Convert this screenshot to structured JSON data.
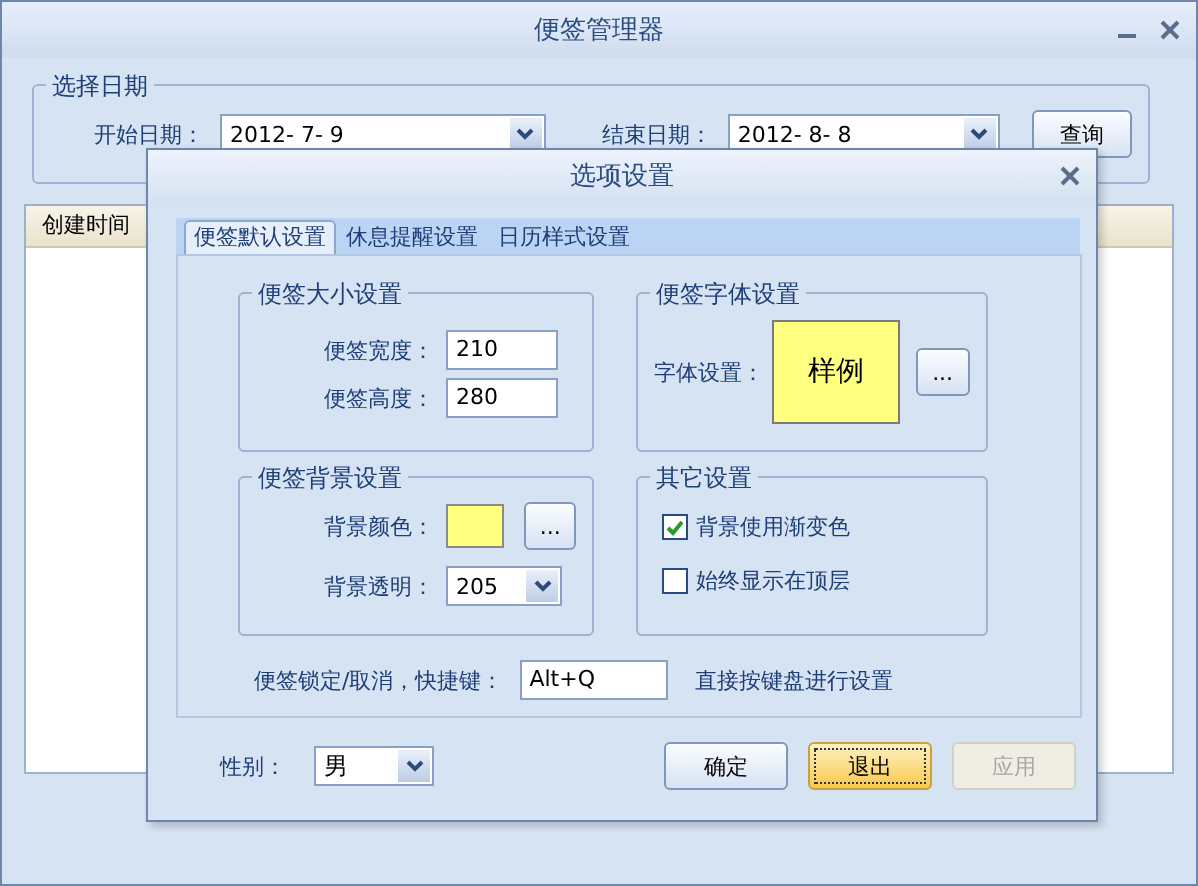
{
  "window": {
    "title": "便签管理器"
  },
  "date_group": {
    "title": "选择日期",
    "start_label": "开始日期：",
    "start_value": "2012-  7-  9",
    "end_label": "结束日期：",
    "end_value": "2012-  8-  8",
    "query_button": "查询"
  },
  "table": {
    "columns": [
      "创建时间"
    ]
  },
  "dialog": {
    "title": "选项设置",
    "tabs": [
      {
        "label": "便签默认设置",
        "selected": true
      },
      {
        "label": "休息提醒设置",
        "selected": false
      },
      {
        "label": "日历样式设置",
        "selected": false
      }
    ],
    "size_group": {
      "title": "便签大小设置",
      "fields": [
        {
          "label": "便签宽度：",
          "value": "210"
        },
        {
          "label": "便签高度：",
          "value": "280"
        }
      ]
    },
    "font_group": {
      "title": "便签字体设置",
      "label": "字体设置：",
      "sample": "样例",
      "browse": "..."
    },
    "background_group": {
      "title": "便签背景设置",
      "color_label": "背景颜色：",
      "color": "#ffff80",
      "browse": "...",
      "opacity_label": "背景透明：",
      "opacity_value": "205"
    },
    "other_group": {
      "title": "其它设置",
      "options": [
        {
          "label": "背景使用渐变色",
          "checked": true
        },
        {
          "label": "始终显示在顶层",
          "checked": false
        }
      ]
    },
    "shortcut": {
      "label": "便签锁定/取消，快捷键：",
      "value": "Alt+Q",
      "hint": "直接按键盘进行设置"
    },
    "gender": {
      "label": "性别：",
      "value": "男"
    },
    "buttons": [
      {
        "label": "确定",
        "focused": false,
        "disabled": false
      },
      {
        "label": "退出",
        "focused": true,
        "disabled": false
      },
      {
        "label": "应用",
        "focused": false,
        "disabled": true
      }
    ]
  }
}
